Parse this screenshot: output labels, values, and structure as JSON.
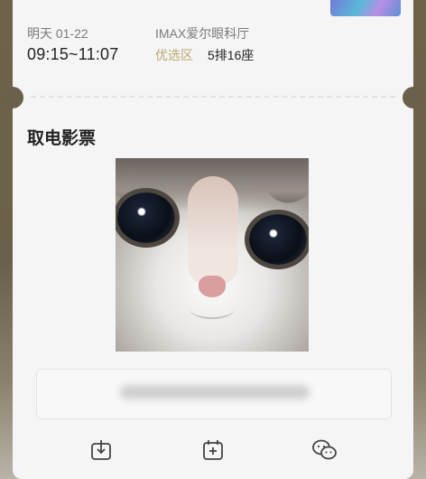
{
  "show": {
    "date": "明天 01-22",
    "time": "09:15~11:07",
    "hall": "IMAX爱尔眼科厅",
    "zone": "优选区",
    "seat": "5排16座"
  },
  "ticket": {
    "section_title": "取电影票"
  },
  "actions": [
    {
      "icon": "download-icon",
      "label": ""
    },
    {
      "icon": "calendar-add-icon",
      "label": ""
    },
    {
      "icon": "wechat-icon",
      "label": ""
    }
  ],
  "colors": {
    "zone_accent": "#b8a76e",
    "frame": "#6b6049"
  }
}
